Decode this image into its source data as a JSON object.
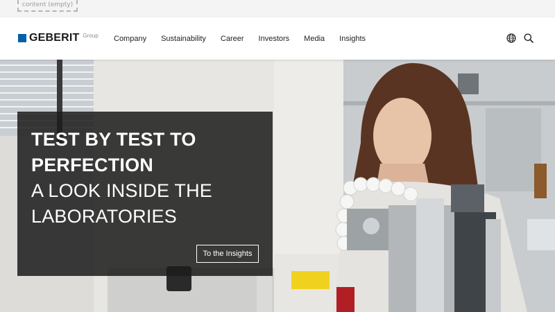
{
  "placeholder": {
    "label": "content (empty)"
  },
  "brand": {
    "name": "GEBERIT",
    "sub": "Group",
    "color": "#0060a8"
  },
  "nav": {
    "items": [
      "Company",
      "Sustainability",
      "Career",
      "Investors",
      "Media",
      "Insights"
    ]
  },
  "icons": {
    "language": "globe-icon",
    "search": "search-icon"
  },
  "hero": {
    "headline_bold_1": "TEST BY TEST TO",
    "headline_bold_2": "PERFECTION",
    "headline_light_1": "A LOOK INSIDE THE",
    "headline_light_2": "LABORATORIES",
    "cta_label": "To the Insights",
    "overlay_color": "#1c1c1c"
  }
}
